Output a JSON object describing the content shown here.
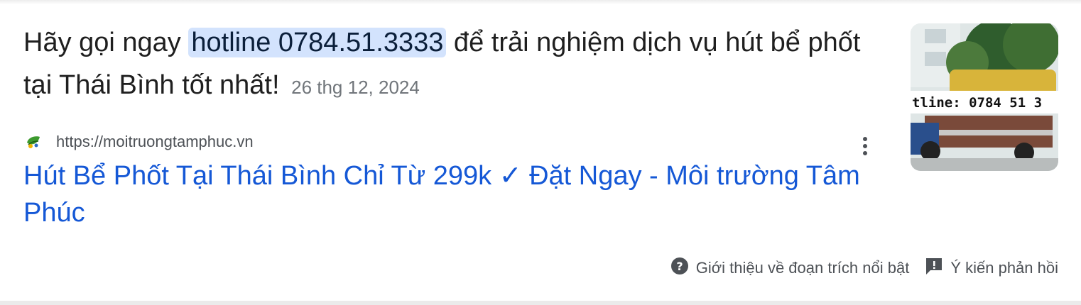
{
  "snippet": {
    "before": "Hãy gọi ngay ",
    "highlight": "hotline 0784.51.3333",
    "after": " để trải nghiệm dịch vụ hút bể phốt tại Thái Bình tốt nhất!",
    "date": "26 thg 12, 2024"
  },
  "source": {
    "url": "https://moitruongtamphuc.vn",
    "favicon": "leaf-logo-icon"
  },
  "result": {
    "title": "Hút Bể Phốt Tại Thái Bình Chỉ Từ 299k ✓ Đặt Ngay - Môi trường Tâm Phúc"
  },
  "thumbnail": {
    "banner_text": "tline: 0784 51 3"
  },
  "footer": {
    "about_label": "Giới thiệu về đoạn trích nổi bật",
    "feedback_label": "Ý kiến phản hồi"
  },
  "colors": {
    "link": "#1558d6",
    "highlight_bg": "#d3e3fd",
    "muted": "#70757a"
  }
}
